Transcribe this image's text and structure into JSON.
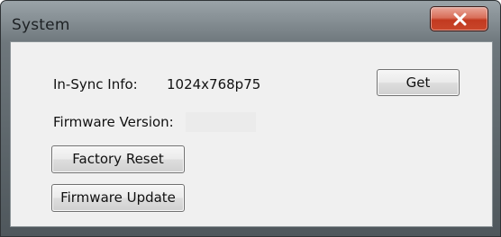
{
  "window": {
    "title": "System",
    "close_glyph": "✕"
  },
  "info": {
    "in_sync_label": "In-Sync Info:",
    "in_sync_value": "1024x768p75",
    "firmware_label": "Firmware Version:",
    "firmware_value": ""
  },
  "buttons": {
    "get": "Get",
    "factory_reset": "Factory Reset",
    "firmware_update": "Firmware Update"
  },
  "colors": {
    "frame": "#5d666b",
    "client_bg": "#f0f0f0",
    "close_button": "#c23a20"
  },
  "icons": {
    "close": "close-icon"
  }
}
